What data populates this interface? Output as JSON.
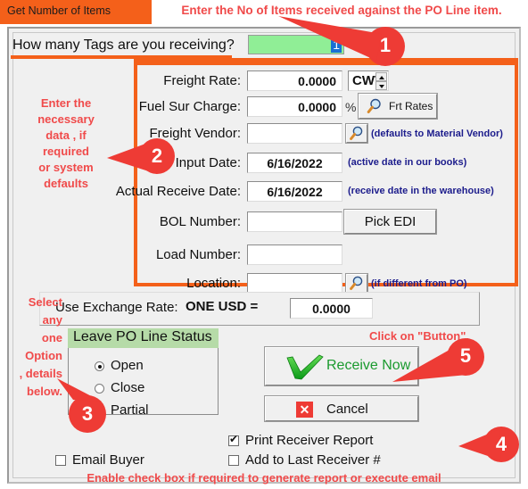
{
  "window": {
    "title": "Get Number of Items",
    "top_hint": "Enter the No of Items received against the PO Line item."
  },
  "tags": {
    "label": "How many Tags are you receiving?",
    "value": "1"
  },
  "fields": [
    {
      "label": "Freight Rate:",
      "value": "0.0000",
      "unit": "CWT",
      "note": ""
    },
    {
      "label": "Fuel Sur Charge:",
      "value": "0.0000",
      "suffix": "%",
      "note": ""
    },
    {
      "label": "Freight Vendor:",
      "value": "",
      "note": "(defaults to Material Vendor)"
    },
    {
      "label": "Input Date:",
      "value": "6/16/2022",
      "note": "(active date in our books)"
    },
    {
      "label": "Actual Receive Date:",
      "value": "6/16/2022",
      "note": "(receive date in the warehouse)"
    },
    {
      "label": "BOL Number:",
      "value": "",
      "note": ""
    },
    {
      "label": "Load Number:",
      "value": "",
      "note": ""
    },
    {
      "label": "Location:",
      "value": "",
      "note": "(if different from PO)"
    }
  ],
  "buttons": {
    "frt_rates": "Frt Rates",
    "pick_edi": "Pick EDI",
    "receive_now": "Receive Now",
    "cancel": "Cancel"
  },
  "exchange": {
    "label": "Use Exchange Rate:",
    "currency": "ONE USD  =",
    "value": "0.0000"
  },
  "po_status": {
    "title": "Leave PO Line Status",
    "options": [
      {
        "label": "Open",
        "selected": true
      },
      {
        "label": "Close",
        "selected": false
      },
      {
        "label": "Partial",
        "selected": false
      }
    ]
  },
  "checkboxes": [
    {
      "label": "Email Buyer",
      "checked": false
    },
    {
      "label": "Print Receiver Report",
      "checked": true
    },
    {
      "label": "Add to Last Receiver #",
      "checked": false
    }
  ],
  "annotations": {
    "left_fields": "Enter the\nnecessary\ndata , if\nrequired\nor system\ndefaults",
    "left_fields_lines": [
      "Enter the",
      "necessary",
      "data , if",
      "required",
      "or system",
      "defaults"
    ],
    "left_option_lines": [
      "Select",
      "any",
      "one",
      "Option",
      ", details",
      "below."
    ],
    "click_button": "Click on \"Button\".",
    "bottom": "Enable check box  if required to generate report or execute email",
    "callouts": [
      "1",
      "2",
      "3",
      "4",
      "5"
    ]
  },
  "colors": {
    "accent_orange": "#f4601a",
    "callout_red": "#ee3b35",
    "annotation_red": "#f04a4a",
    "note_blue": "#1c1c8c",
    "green_input": "#90ee96",
    "group_header_green": "#b6dba8",
    "receive_green": "#1a9a2e"
  }
}
